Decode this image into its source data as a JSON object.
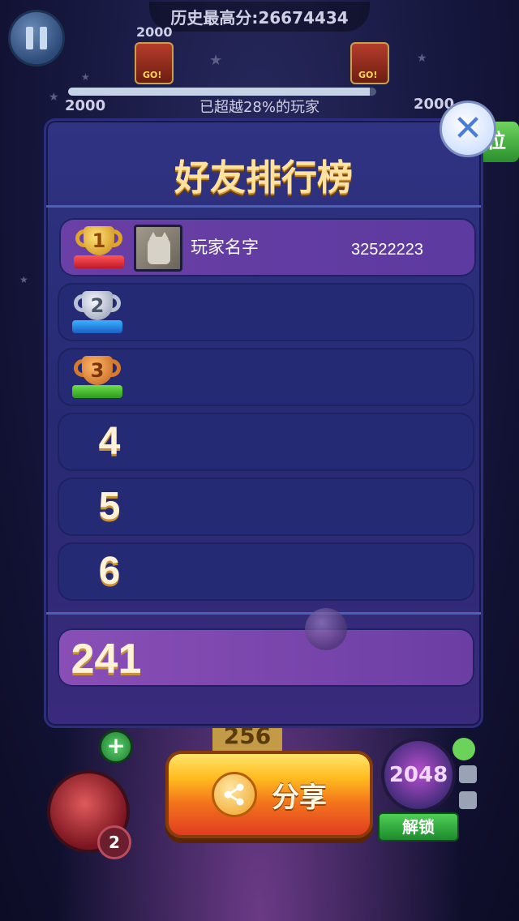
{
  "hud": {
    "high_score": "历史最高分:26674434",
    "score_left": "2000",
    "score_top": "2000",
    "score_right": "2000",
    "beaten_text": "已超越28%的玩家",
    "progress_fraction": 0.98,
    "partial_button_label": "位"
  },
  "leaderboard": {
    "title": "好友排行榜",
    "entries": [
      {
        "rank": "1",
        "name": "玩家名字",
        "score": "32522223"
      },
      {
        "rank": "2"
      },
      {
        "rank": "3"
      },
      {
        "rank": "4"
      },
      {
        "rank": "5"
      },
      {
        "rank": "6"
      }
    ],
    "my_rank": "241"
  },
  "game": {
    "tile_value": "256",
    "gem_count": "2",
    "locked_tile_value": "2048",
    "unlock_label": "解锁"
  },
  "share": {
    "label": "分享"
  },
  "icons": {
    "pause": "pause-icon",
    "close": "close-icon",
    "share": "share-icon"
  },
  "colors": {
    "title": "#ffe2a0",
    "panel": "#2f3382",
    "share_button": "#f3751c"
  }
}
